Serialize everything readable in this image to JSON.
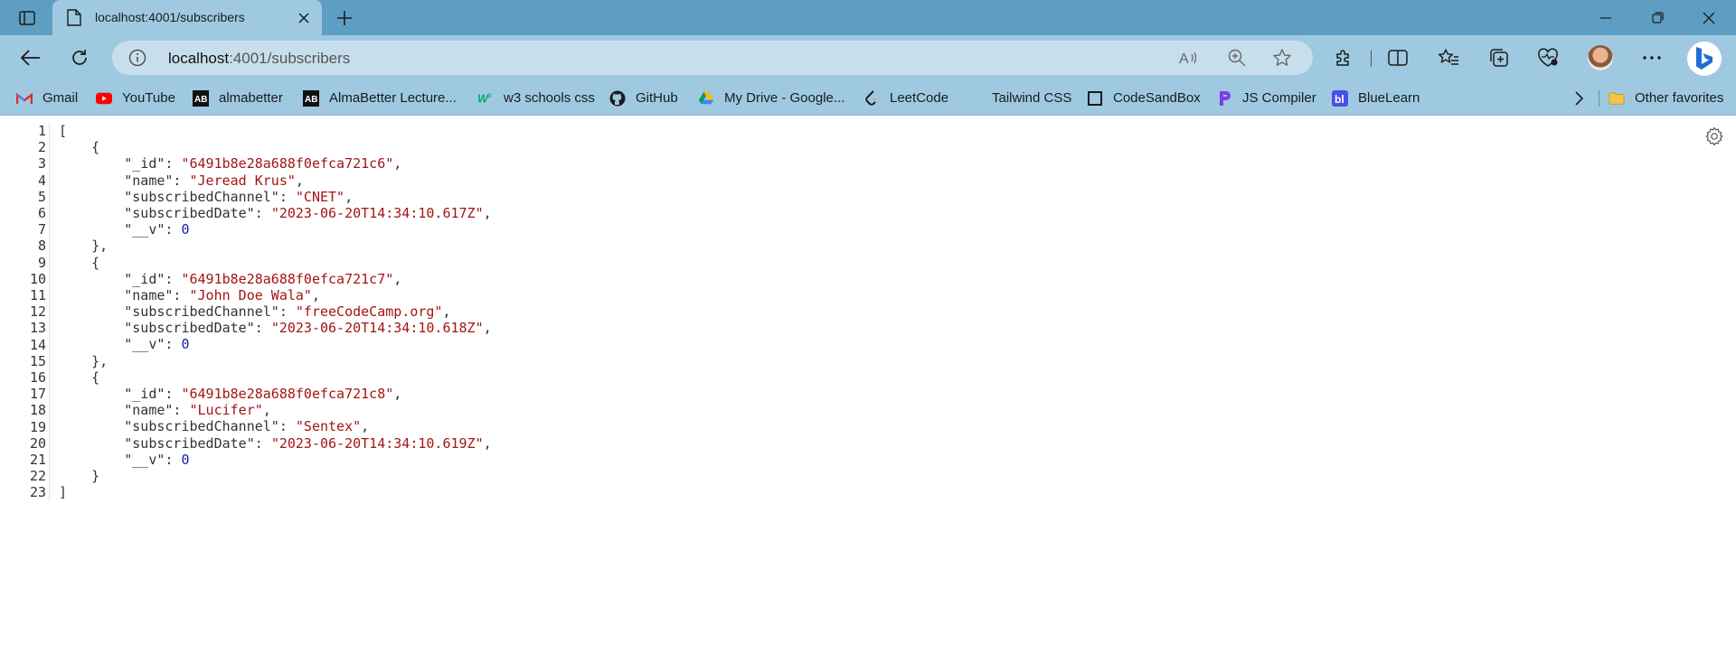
{
  "tab": {
    "title": "localhost:4001/subscribers"
  },
  "address": {
    "host": "localhost",
    "path": ":4001/subscribers"
  },
  "favorites": [
    {
      "label": "Gmail",
      "icon": "gmail-icon"
    },
    {
      "label": "YouTube",
      "icon": "youtube-icon"
    },
    {
      "label": "almabetter",
      "icon": "almabetter-icon"
    },
    {
      "label": "AlmaBetter Lecture...",
      "icon": "almabetter-icon"
    },
    {
      "label": "w3 schools css",
      "icon": "w3schools-icon"
    },
    {
      "label": "GitHub",
      "icon": "github-icon"
    },
    {
      "label": "My Drive - Google...",
      "icon": "google-drive-icon"
    },
    {
      "label": "LeetCode",
      "icon": "leetcode-icon"
    },
    {
      "label": "Tailwind CSS",
      "icon": "tailwind-icon"
    },
    {
      "label": "CodeSandBox",
      "icon": "codesandbox-icon"
    },
    {
      "label": "JS Compiler",
      "icon": "js-compiler-icon"
    },
    {
      "label": "BlueLearn",
      "icon": "bluelearn-icon"
    }
  ],
  "other_favorites": "Other favorites",
  "json": {
    "records": [
      {
        "_id": "6491b8e28a688f0efca721c6",
        "name": "Jeread Krus",
        "subscribedChannel": "CNET",
        "subscribedDate": "2023-06-20T14:34:10.617Z",
        "__v": 0
      },
      {
        "_id": "6491b8e28a688f0efca721c7",
        "name": "John Doe Wala",
        "subscribedChannel": "freeCodeCamp.org",
        "subscribedDate": "2023-06-20T14:34:10.618Z",
        "__v": 0
      },
      {
        "_id": "6491b8e28a688f0efca721c8",
        "name": "Lucifer",
        "subscribedChannel": "Sentex",
        "subscribedDate": "2023-06-20T14:34:10.619Z",
        "__v": 0
      }
    ],
    "line_count": 23
  },
  "colors": {
    "titlebar": "#5e9ec3",
    "toolbar": "#9fc9e1",
    "json_string": "#a31515",
    "json_number": "#1a1aa6"
  }
}
